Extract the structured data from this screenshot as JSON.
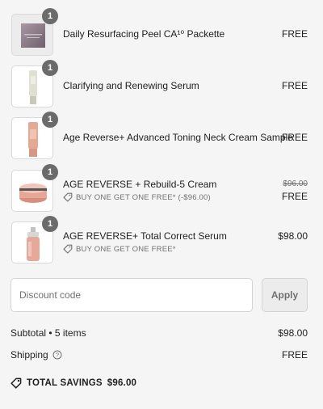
{
  "items": [
    {
      "quantity": "1",
      "name": "Daily Resurfacing Peel CA¹⁰ Packette",
      "price": "FREE",
      "image": "packette-product-icon"
    },
    {
      "quantity": "1",
      "name": "Clarifying and Renewing Serum",
      "price": "FREE",
      "image": "serum-tube-icon"
    },
    {
      "quantity": "1",
      "name": "Age Reverse+ Advanced Toning Neck Cream Sample",
      "price": "FREE",
      "image": "neck-cream-tube-icon"
    },
    {
      "quantity": "1",
      "name": "AGE REVERSE + Rebuild-5 Cream",
      "original_price": "$96.00",
      "price": "FREE",
      "promo": "BUY ONE GET ONE FREE* (-$96.00)",
      "image": "cream-jar-icon"
    },
    {
      "quantity": "1",
      "name": "AGE REVERSE+ Total Correct Serum",
      "price": "$98.00",
      "promo": "BUY ONE GET ONE FREE*",
      "image": "pump-bottle-icon"
    }
  ],
  "discount": {
    "placeholder": "Discount code",
    "apply_label": "Apply"
  },
  "summary": {
    "subtotal_label": "Subtotal • 5 items",
    "subtotal_value": "$98.00",
    "shipping_label": "Shipping",
    "shipping_value": "FREE",
    "savings_label": "TOTAL SAVINGS",
    "savings_value": "$96.00"
  },
  "colors": {
    "background": "#f5f5f5",
    "badge": "#6b6b6b",
    "text": "#1f1f1f",
    "muted": "#707070",
    "product_pink": "#e8b8a8"
  }
}
